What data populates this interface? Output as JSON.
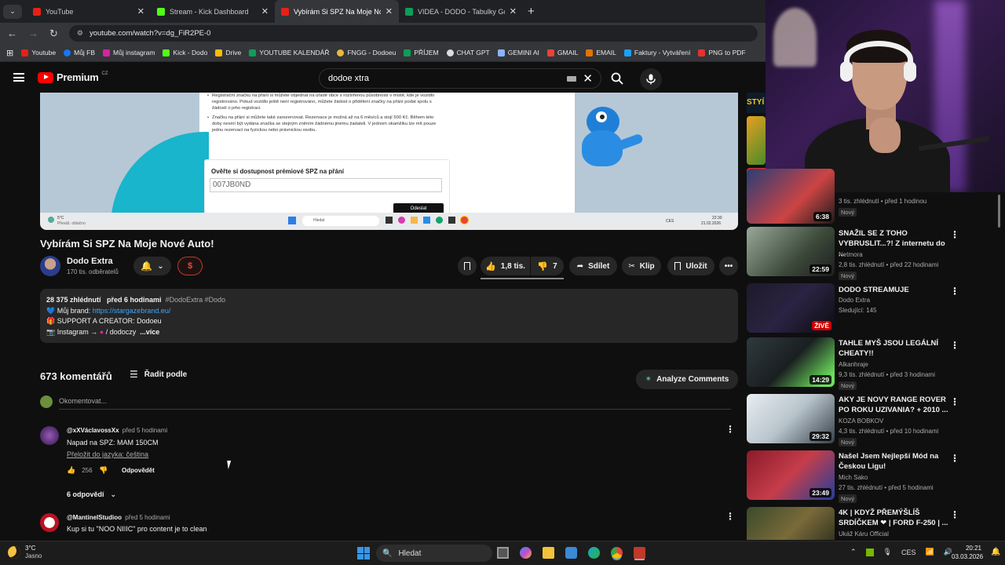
{
  "browser": {
    "tabs": [
      {
        "title": "YouTube",
        "color": "#e62117"
      },
      {
        "title": "Stream - Kick Dashboard",
        "color": "#53fc18"
      },
      {
        "title": "Vybírám Si SPZ Na Moje Nové ...",
        "color": "#e62117"
      },
      {
        "title": "VIDEA - DODO - Tabulky Googl...",
        "color": "#0f9d58"
      }
    ],
    "url": "youtube.com/watch?v=dg_FiR2PE-0",
    "bookmarks": [
      "Youtube",
      "Můj FB",
      "Můj instagram",
      "Kick - Dodo",
      "Drive",
      "YOUTUBE KALENDÁŘ",
      "FNGG - Dodoeu",
      "PŘÍJEM",
      "CHAT GPT",
      "GEMINI AI",
      "GMAIL",
      "EMAIL",
      "Faktury - Vytváření",
      "PNG to PDF"
    ]
  },
  "youtube": {
    "logo": "Premium",
    "logo_sup": "CZ",
    "search_value": "dodoe xtra"
  },
  "video_frame": {
    "bullet1": "Registrační značku na přání si můžete objednat na úřadě obce s rozšířenou působností v místě, kde je vozidlo registrováno. Pokud vozidlo ještě není registrováno, můžete žádost o přidělení značky na přání podat spolu s žádostí o jeho registraci.",
    "bullet2": "Značku na přání si můžete také zarezervovat. Rezervace je možná až na 6 měsíců a stojí 500 Kč. Během této doby nesmí být vydána značka se stejným zněním žádnému jinému žadateli. V jednom okamžiku lze mít pouze jednu rezervaci na fyzickou nebo právnickou osobu.",
    "check_title": "Ověřte si dostupnost prémiové SPZ na přání",
    "plate_value": "007JB0ND",
    "button": "Odeslat",
    "weather": "5°C",
    "weather_sub": "Převáž. oblačno",
    "search": "Hledat",
    "time": "22:30",
    "date": "21.02.2026",
    "lang": "CES"
  },
  "video": {
    "title": "Vybírám Si SPZ Na Moje Nové Auto!",
    "channel": "Dodo Extra",
    "subscribers": "170 tis. odběratelů",
    "likes": "1,8 tis.",
    "dislikes": "7",
    "share": "Sdílet",
    "clip": "Klip",
    "save": "Uložit",
    "views": "28 375 zhlédnutí",
    "age": "před 6 hodinami",
    "tags": "#DodoExtra #Dodo",
    "desc_brand_label": "Můj brand:",
    "desc_brand_link": "https://stargazebrand.eu/",
    "desc_support": "SUPPORT A CREATOR: Dodoeu",
    "desc_instagram": "Instagram →",
    "desc_ig_handle": "/ dodoczy",
    "more": "...více"
  },
  "comments": {
    "count": "673 komentářů",
    "sort": "Řadit podle",
    "analyze": "Analyze Comments",
    "placeholder": "Okomentovat...",
    "items": [
      {
        "author": "@xXVáclavossXx",
        "time": "před 5 hodinami",
        "text": "Napad na SPZ: MAM 150CM",
        "translate": "Přeložit do jazyka: čeština",
        "likes": "256",
        "reply": "Odpovědět",
        "replies": "6 odpovědí"
      },
      {
        "author": "@MantinelStudioo",
        "time": "před 5 hodinami",
        "text": "Kup si tu \"NOO NIIIC\" pro content je to clean"
      }
    ]
  },
  "recommended": [
    {
      "title": "",
      "channel": "",
      "meta": "3 tis. zhlédnutí • před 1 hodinou",
      "badge": "Nový",
      "duration": "6:38"
    },
    {
      "title": "SNAŽIL SE Z TOHO VYBRUSLIT...?! Z internetu do ...",
      "channel": "Netmora",
      "meta": "2,8 tis. zhlédnutí • před 22 hodinami",
      "badge": "Nový",
      "duration": "22:59"
    },
    {
      "title": "DODO STREAMUJE",
      "channel": "Dodo Extra",
      "meta": "Sledující: 145",
      "badge": "",
      "duration": "ŽIVĚ"
    },
    {
      "title": "TAHLE MYŠ JSOU LEGÁLNÍ CHEATY!!",
      "channel": "Alkanhraje",
      "meta": "9,3 tis. zhlédnutí • před 3 hodinami",
      "badge": "Nový",
      "duration": "14:29"
    },
    {
      "title": "AKY JE NOVY RANGE ROVER PO ROKU UZIVANIA? + 2010 ...",
      "channel": "KOZA BOBKOV",
      "meta": "4,3 tis. zhlédnutí • před 10 hodinami",
      "badge": "Nový",
      "duration": "29:32"
    },
    {
      "title": "Našel Jsem Nejlepší Mód na Českou Ligu!",
      "channel": "Mich Sako",
      "meta": "27 tis. zhlédnutí • před 5 hodinami",
      "badge": "Nový",
      "duration": "23:49"
    },
    {
      "title": "4K | KDYŽ PŘEMÝŠLÍŠ SRDÍČKEM ❤ | FORD F-250 | ...",
      "channel": "Ukáž Káru Official",
      "meta": "",
      "badge": "",
      "duration": ""
    }
  ],
  "taskbar": {
    "weather_temp": "3°C",
    "weather_text": "Jasno",
    "search": "Hledat",
    "lang": "CES",
    "time": "20:21",
    "date": "03.03.2026"
  }
}
